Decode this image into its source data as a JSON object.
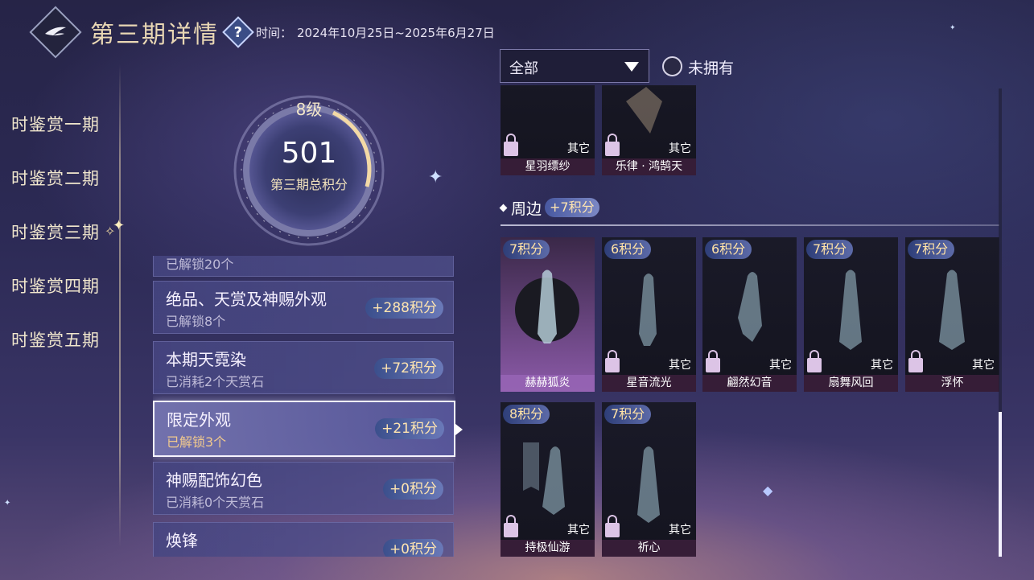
{
  "header": {
    "title": "第三期详情",
    "time_label": "时间：",
    "time_value": "2024年10月25日~2025年6月27日"
  },
  "periods": [
    {
      "label": "时鉴赏一期"
    },
    {
      "label": "时鉴赏二期"
    },
    {
      "label": "时鉴赏三期",
      "active": true
    },
    {
      "label": "时鉴赏四期"
    },
    {
      "label": "时鉴赏五期"
    }
  ],
  "score": {
    "level": "8级",
    "total": "501",
    "caption": "第三期总积分"
  },
  "categories": [
    {
      "name": "",
      "sub": "已解锁20个",
      "points": ""
    },
    {
      "name": "绝品、天赏及神赐外观",
      "sub": "已解锁8个",
      "points": "+288积分"
    },
    {
      "name": "本期天霓染",
      "sub": "已消耗2个天赏石",
      "points": "+72积分"
    },
    {
      "name": "限定外观",
      "sub": "已解锁3个",
      "points": "+21积分",
      "selected": true
    },
    {
      "name": "神赐配饰幻色",
      "sub": "已消耗0个天赏石",
      "points": "+0积分"
    },
    {
      "name": "焕锋",
      "sub": "",
      "points": "+0积分"
    }
  ],
  "filter": {
    "value": "全部",
    "owned_label": "未拥有"
  },
  "top_cards": [
    {
      "type": "其它",
      "name": "星羽缥纱"
    },
    {
      "type": "其它",
      "name": "乐律 · 鸿鹄天"
    }
  ],
  "section": {
    "title": "周边",
    "points": "+7积分"
  },
  "cards": [
    {
      "points": "7积分",
      "type": "",
      "name": "赫赫狐炎",
      "highlight": true
    },
    {
      "points": "6积分",
      "type": "其它",
      "name": "星音流光"
    },
    {
      "points": "6积分",
      "type": "其它",
      "name": "翩然幻音"
    },
    {
      "points": "7积分",
      "type": "其它",
      "name": "扇舞风回"
    },
    {
      "points": "7积分",
      "type": "其它",
      "name": "浮怀"
    },
    {
      "points": "8积分",
      "type": "其它",
      "name": "持极仙游"
    },
    {
      "points": "7积分",
      "type": "其它",
      "name": "祈心"
    }
  ],
  "colors": {
    "accent_gold": "#f1e7cd",
    "points_text": "#ffe2a6",
    "badge_blue": "#3b4f8c",
    "highlight_card": "#8b5aa8"
  },
  "scroll": {
    "position_fraction": 0.69
  }
}
